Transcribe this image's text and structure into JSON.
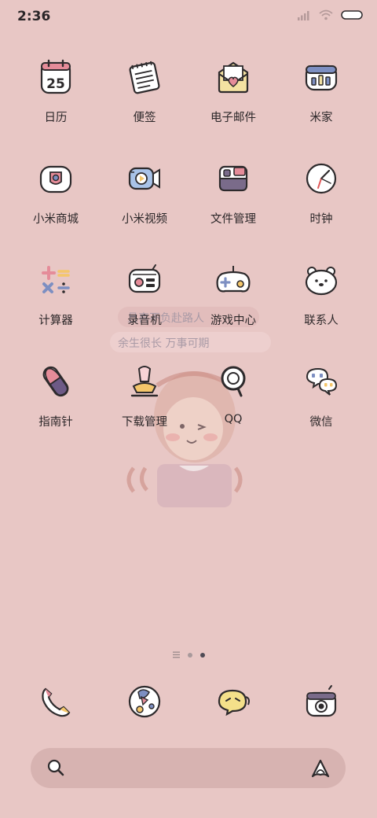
{
  "status": {
    "time": "2:36"
  },
  "apps": [
    [
      {
        "label": "日历",
        "icon": "calendar-icon",
        "day": "25"
      },
      {
        "label": "便签",
        "icon": "notes-icon"
      },
      {
        "label": "电子邮件",
        "icon": "email-icon"
      },
      {
        "label": "米家",
        "icon": "mihome-icon"
      }
    ],
    [
      {
        "label": "小米商城",
        "icon": "mistore-icon"
      },
      {
        "label": "小米视频",
        "icon": "video-icon"
      },
      {
        "label": "文件管理",
        "icon": "files-icon"
      },
      {
        "label": "时钟",
        "icon": "clock-icon"
      }
    ],
    [
      {
        "label": "计算器",
        "icon": "calculator-icon"
      },
      {
        "label": "录音机",
        "icon": "recorder-icon"
      },
      {
        "label": "游戏中心",
        "icon": "gamepad-icon"
      },
      {
        "label": "联系人",
        "icon": "contacts-icon"
      }
    ],
    [
      {
        "label": "指南针",
        "icon": "compass-icon"
      },
      {
        "label": "下载管理",
        "icon": "download-icon"
      },
      {
        "label": "QQ",
        "icon": "qq-icon"
      },
      {
        "label": "微信",
        "icon": "wechat-icon"
      }
    ]
  ],
  "dock": [
    {
      "name": "phone",
      "icon": "phone-icon"
    },
    {
      "name": "browser",
      "icon": "browser-icon"
    },
    {
      "name": "messages",
      "icon": "messages-icon"
    },
    {
      "name": "camera",
      "icon": "camera-icon"
    }
  ],
  "search": {
    "placeholder": ""
  },
  "page_indicator": {
    "pages": 2,
    "current": 2
  },
  "wallpaper": {
    "text_line1": "且喜不负赴路人",
    "text_line2": "余生很长 万事可期"
  },
  "colors": {
    "background": "#e8c7c5",
    "search_bar": "#d7b3b1",
    "outline": "#2d2a2c",
    "accent_blue": "#7d8fc2",
    "accent_pink": "#e58c99",
    "accent_yellow": "#f4e2a2"
  }
}
